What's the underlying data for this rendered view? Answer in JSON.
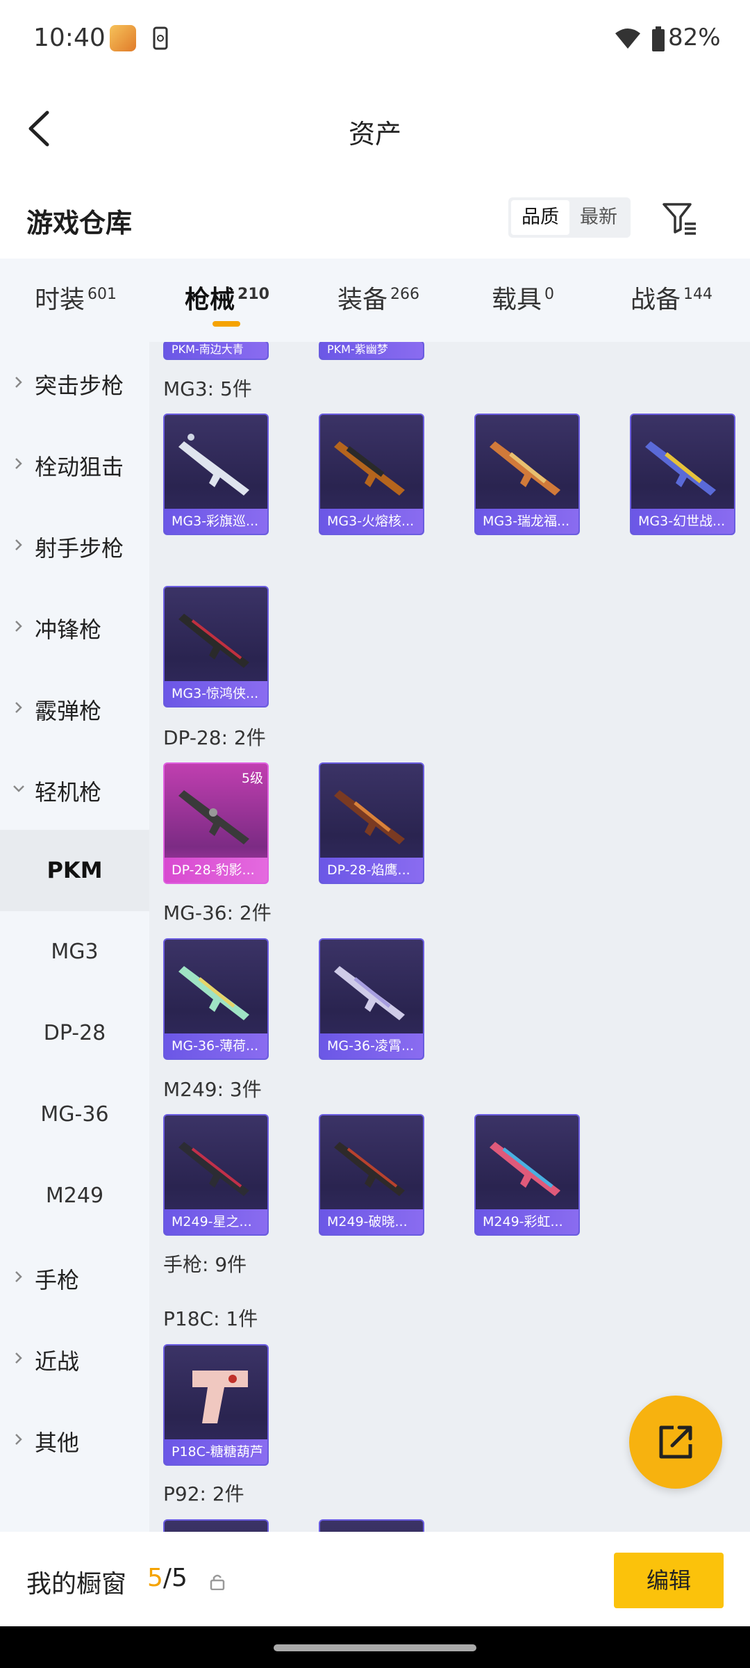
{
  "status_bar": {
    "time": "10:40",
    "battery": "82%"
  },
  "header": {
    "title": "资产"
  },
  "warehouse": {
    "title": "游戏仓库",
    "sort_quality": "品质",
    "sort_latest": "最新"
  },
  "tabs": [
    {
      "label": "时装",
      "count": "601"
    },
    {
      "label": "枪械",
      "count": "210"
    },
    {
      "label": "装备",
      "count": "266"
    },
    {
      "label": "载具",
      "count": "0"
    },
    {
      "label": "战备",
      "count": "144"
    }
  ],
  "sidebar": {
    "items": [
      "突击步枪",
      "栓动狙击",
      "射手步枪",
      "冲锋枪",
      "霰弹枪",
      "轻机枪"
    ],
    "subitems": [
      "PKM",
      "MG3",
      "DP-28",
      "MG-36",
      "M249"
    ],
    "bottom_items": [
      "手枪",
      "近战",
      "其他"
    ]
  },
  "content": {
    "partial_top": [
      "PKM-南边大青",
      "PKM-紫幽梦"
    ],
    "groups": {
      "mg3": {
        "title": "MG3: 5件",
        "cards": [
          "MG3-彩旗巡...",
          "MG3-火熔核...",
          "MG3-瑞龙福...",
          "MG3-幻世战...",
          "MG3-惊鸿侠..."
        ]
      },
      "dp28": {
        "title": "DP-28: 2件",
        "cards": [
          "DP-28-豹影...",
          "DP-28-焰鹰..."
        ],
        "level": "5级"
      },
      "mg36": {
        "title": "MG-36: 2件",
        "cards": [
          "MG-36-薄荷...",
          "MG-36-凌霄..."
        ]
      },
      "m249": {
        "title": "M249: 3件",
        "cards": [
          "M249-星之...",
          "M249-破晓...",
          "M249-彩虹..."
        ]
      },
      "pistol": {
        "title": "手枪: 9件"
      },
      "p18c": {
        "title": "P18C: 1件",
        "cards": [
          "P18C-糖糖葫芦"
        ]
      },
      "p92": {
        "title": "P92: 2件"
      }
    }
  },
  "bottom": {
    "label": "我的橱窗",
    "count_current": "5",
    "count_total": "/5",
    "edit_label": "编辑"
  },
  "colors": {
    "accent": "#f5a300",
    "card_purple": "#6b57e6",
    "card_pink": "#d84ad0",
    "sidebar_bg": "#f3f6fa",
    "content_bg": "#eceff3"
  }
}
